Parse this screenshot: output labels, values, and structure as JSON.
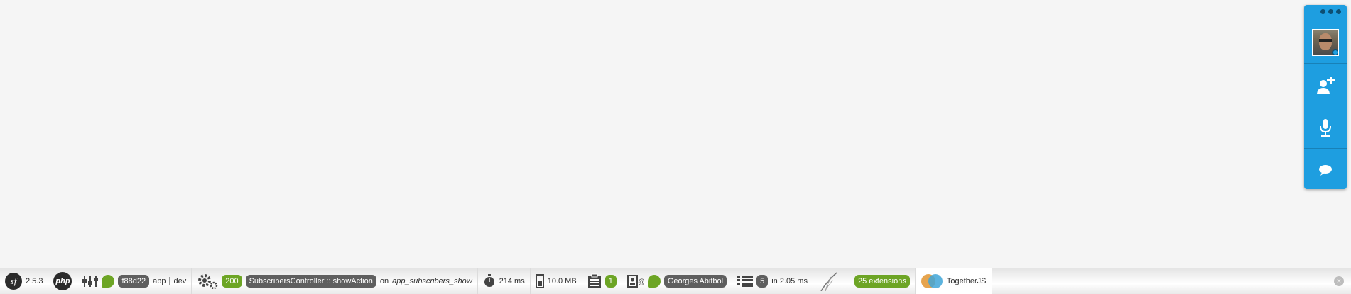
{
  "together_dock": {
    "items": [
      {
        "name": "profile",
        "icon": "avatar-with-gear-icon"
      },
      {
        "name": "invite",
        "icon": "add-person-icon"
      },
      {
        "name": "audio",
        "icon": "microphone-icon"
      },
      {
        "name": "chat",
        "icon": "chat-bubble-icon"
      }
    ],
    "color": "#1e9ee0"
  },
  "toolbar": {
    "symfony": {
      "logo_text": "sf",
      "version": "2.5.3"
    },
    "php": {
      "logo_text": "php"
    },
    "config": {
      "token": "f88d22",
      "app_name": "app",
      "environment": "dev"
    },
    "request": {
      "status_code": "200",
      "controller": "SubscribersController",
      "separator": "::",
      "action": "showAction",
      "route_prefix": "on",
      "route": "app_subscribers_show"
    },
    "timer": {
      "value": "214 ms"
    },
    "memory": {
      "value": "10.0 MB"
    },
    "logs": {
      "count": "1"
    },
    "security": {
      "user": "Georges Abitbol"
    },
    "db": {
      "queries": "5",
      "time": "in 2.05 ms"
    },
    "twig": {
      "extensions": "25 extensions"
    },
    "togetherjs": {
      "label": "TogetherJS"
    },
    "close": {
      "symbol": "×"
    }
  },
  "colors": {
    "green": "#6da525",
    "gray_pill": "#5f5f5f",
    "together_blue": "#1e9ee0"
  }
}
